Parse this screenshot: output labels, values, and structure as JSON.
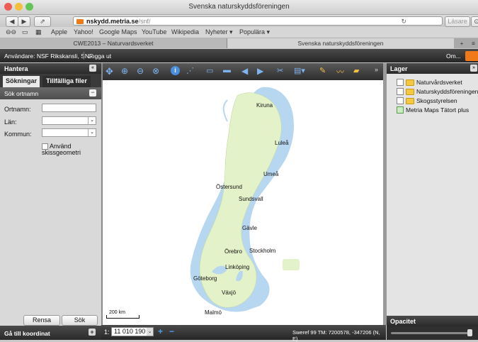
{
  "browser": {
    "window_title": "Svenska naturskyddsföreningen",
    "url_host": "nskydd.metria.se",
    "url_path": "/snf/",
    "reader_label": "Läsare",
    "bookmarks": [
      "Apple",
      "Yahoo!",
      "Google Maps",
      "YouTube",
      "Wikipedia",
      "Nyheter ▾",
      "Populära ▾"
    ],
    "tabs": [
      "CWE2013 – Naturvardsverket",
      "Svenska naturskyddsföreningen"
    ]
  },
  "header": {
    "user": "Användare: NSF Rikskansli, SNF",
    "logout": "Logga ut",
    "about": "Om..."
  },
  "left": {
    "title": "Hantera",
    "tabs": [
      "Sökningar",
      "Tillfälliga filer"
    ],
    "section": "Sök ortnamn",
    "fields": {
      "ortnamn": "Ortnamn:",
      "lan": "Län:",
      "kommun": "Kommun:"
    },
    "checkbox_label_1": "Använd",
    "checkbox_label_2": "skissgeometri",
    "clear_button": "Rensa",
    "search_button": "Sök",
    "footer": "Gå till koordinat"
  },
  "map": {
    "cities": [
      "Kiruna",
      "Luleå",
      "Umeå",
      "Östersund",
      "Sundsvall",
      "Gävle",
      "Örebro",
      "Stockholm",
      "Linköping",
      "Göteborg",
      "Växjö",
      "Malmö"
    ],
    "scale_bar_label": "200 km",
    "scale_prefix": "1:",
    "scale_value": "11 010 190",
    "coordinates": "Sweref 99 TM: 7200578, -347206 (N, E)"
  },
  "right": {
    "title": "Lager",
    "layers": [
      "Naturvårdsverket",
      "Naturskyddsföreningen",
      "Skogsstyrelsen",
      "Metria Maps Tätort plus"
    ],
    "opacity_label": "Opacitet"
  },
  "colors": {
    "land": "#e4f2c9",
    "water": "#b7d6f0",
    "header_dark": "#2b2b2b"
  }
}
